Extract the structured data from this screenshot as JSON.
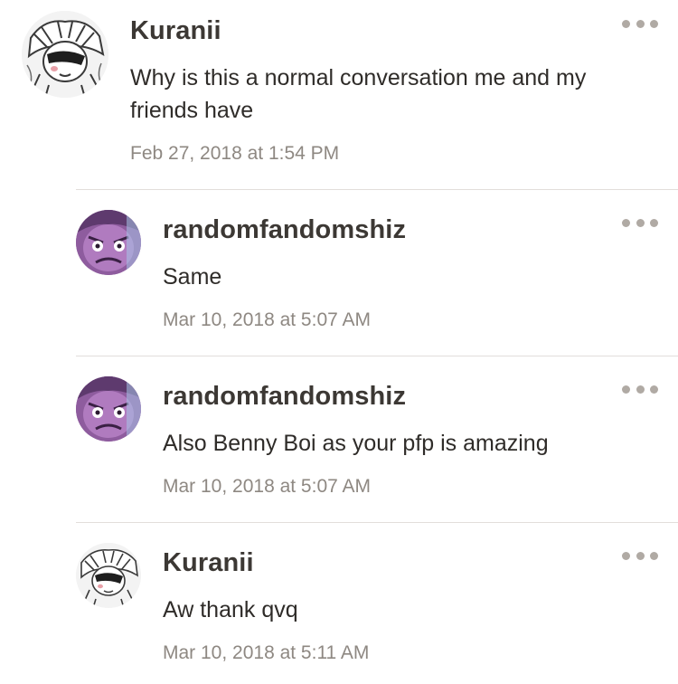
{
  "comments": [
    {
      "author": "Kuranii",
      "text": "Why is this a normal conversation me and my friends have",
      "timestamp": "Feb 27, 2018 at 1:54 PM",
      "avatar": "anime-character-sketch-avatar"
    },
    {
      "author": "randomfandomshiz",
      "text": "Same",
      "timestamp": "Mar 10, 2018 at 5:07 AM",
      "avatar": "purple-character-avatar"
    },
    {
      "author": "randomfandomshiz",
      "text": "Also Benny Boi as your pfp is amazing",
      "timestamp": "Mar 10, 2018 at 5:07 AM",
      "avatar": "purple-character-avatar"
    },
    {
      "author": "Kuranii",
      "text": "Aw thank qvq",
      "timestamp": "Mar 10, 2018 at 5:11 AM",
      "avatar": "anime-character-sketch-avatar"
    }
  ],
  "icons": {
    "more": "more-options-icon"
  },
  "colors": {
    "author": "#3c3834",
    "timestamp": "#8e8882",
    "dots": "#b0aaa4",
    "divider": "#e2dedb"
  }
}
